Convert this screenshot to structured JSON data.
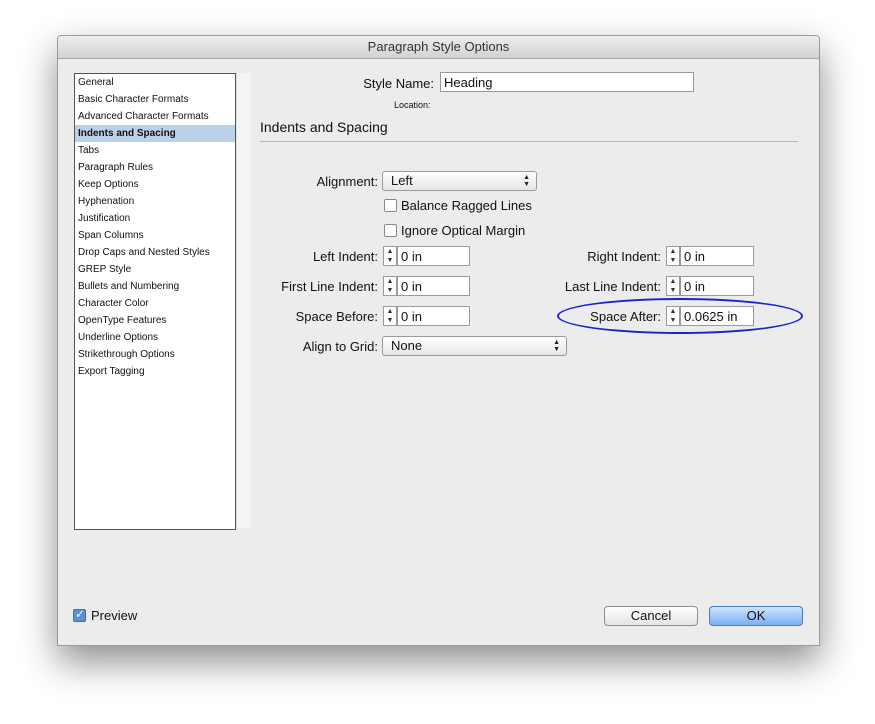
{
  "window": {
    "title": "Paragraph Style Options"
  },
  "sidebar": {
    "items": [
      {
        "label": "General"
      },
      {
        "label": "Basic Character Formats"
      },
      {
        "label": "Advanced Character Formats"
      },
      {
        "label": "Indents and Spacing"
      },
      {
        "label": "Tabs"
      },
      {
        "label": "Paragraph Rules"
      },
      {
        "label": "Keep Options"
      },
      {
        "label": "Hyphenation"
      },
      {
        "label": "Justification"
      },
      {
        "label": "Span Columns"
      },
      {
        "label": "Drop Caps and Nested Styles"
      },
      {
        "label": "GREP Style"
      },
      {
        "label": "Bullets and Numbering"
      },
      {
        "label": "Character Color"
      },
      {
        "label": "OpenType Features"
      },
      {
        "label": "Underline Options"
      },
      {
        "label": "Strikethrough Options"
      },
      {
        "label": "Export Tagging"
      }
    ],
    "selected": "Indents and Spacing"
  },
  "style_name": {
    "label": "Style Name:",
    "value": "Heading",
    "location_label": "Location:"
  },
  "section": {
    "title": "Indents and Spacing"
  },
  "fields": {
    "alignment": {
      "label": "Alignment:",
      "value": "Left"
    },
    "balance_ragged": {
      "label": "Balance Ragged Lines",
      "checked": false
    },
    "ignore_optical": {
      "label": "Ignore Optical Margin",
      "checked": false
    },
    "left_indent": {
      "label": "Left Indent:",
      "value": "0 in"
    },
    "right_indent": {
      "label": "Right Indent:",
      "value": "0 in"
    },
    "first_line_indent": {
      "label": "First Line Indent:",
      "value": "0 in"
    },
    "last_line_indent": {
      "label": "Last Line Indent:",
      "value": "0 in"
    },
    "space_before": {
      "label": "Space Before:",
      "value": "0 in"
    },
    "space_after": {
      "label": "Space After:",
      "value": "0.0625 in"
    },
    "align_to_grid": {
      "label": "Align to Grid:",
      "value": "None"
    }
  },
  "footer": {
    "preview_label": "Preview",
    "preview_checked": true,
    "cancel_label": "Cancel",
    "ok_label": "OK"
  },
  "colors": {
    "highlight_ellipse": "#1a22c8",
    "selected_item": "#bcd0e8",
    "default_button": "#78aef0"
  },
  "icons": {
    "spinner": "up-down-arrows",
    "select": "chevron-up-down",
    "check": "checkmark"
  }
}
